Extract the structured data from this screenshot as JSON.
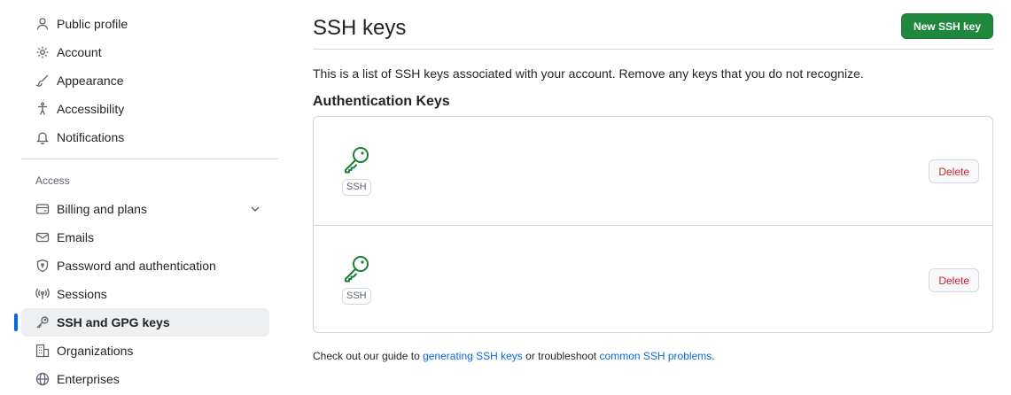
{
  "sidebar": {
    "items_top": [
      {
        "label": "Public profile",
        "icon": "person-icon"
      },
      {
        "label": "Account",
        "icon": "gear-icon"
      },
      {
        "label": "Appearance",
        "icon": "paintbrush-icon"
      },
      {
        "label": "Accessibility",
        "icon": "accessibility-icon"
      },
      {
        "label": "Notifications",
        "icon": "bell-icon"
      }
    ],
    "section_access": "Access",
    "items_access": [
      {
        "label": "Billing and plans",
        "icon": "credit-card-icon"
      },
      {
        "label": "Emails",
        "icon": "mail-icon"
      },
      {
        "label": "Password and authentication",
        "icon": "shield-lock-icon"
      },
      {
        "label": "Sessions",
        "icon": "broadcast-icon"
      },
      {
        "label": "SSH and GPG keys",
        "icon": "key-icon"
      },
      {
        "label": "Organizations",
        "icon": "organization-icon"
      },
      {
        "label": "Enterprises",
        "icon": "globe-icon"
      }
    ]
  },
  "main": {
    "title": "SSH keys",
    "new_button": "New SSH key",
    "description": "This is a list of SSH keys associated with your account. Remove any keys that you do not recognize.",
    "subheading": "Authentication Keys",
    "keys": [
      {
        "type_label": "SSH",
        "delete_label": "Delete"
      },
      {
        "type_label": "SSH",
        "delete_label": "Delete"
      }
    ],
    "footer": {
      "prefix": "Check out our guide to ",
      "link1": "generating SSH keys",
      "middle": " or troubleshoot ",
      "link2": "common SSH problems",
      "suffix": "."
    }
  },
  "colors": {
    "accent": "#0969da",
    "primary_button": "#1f883d",
    "key_icon": "#1a7f37",
    "danger": "#cf222e"
  }
}
